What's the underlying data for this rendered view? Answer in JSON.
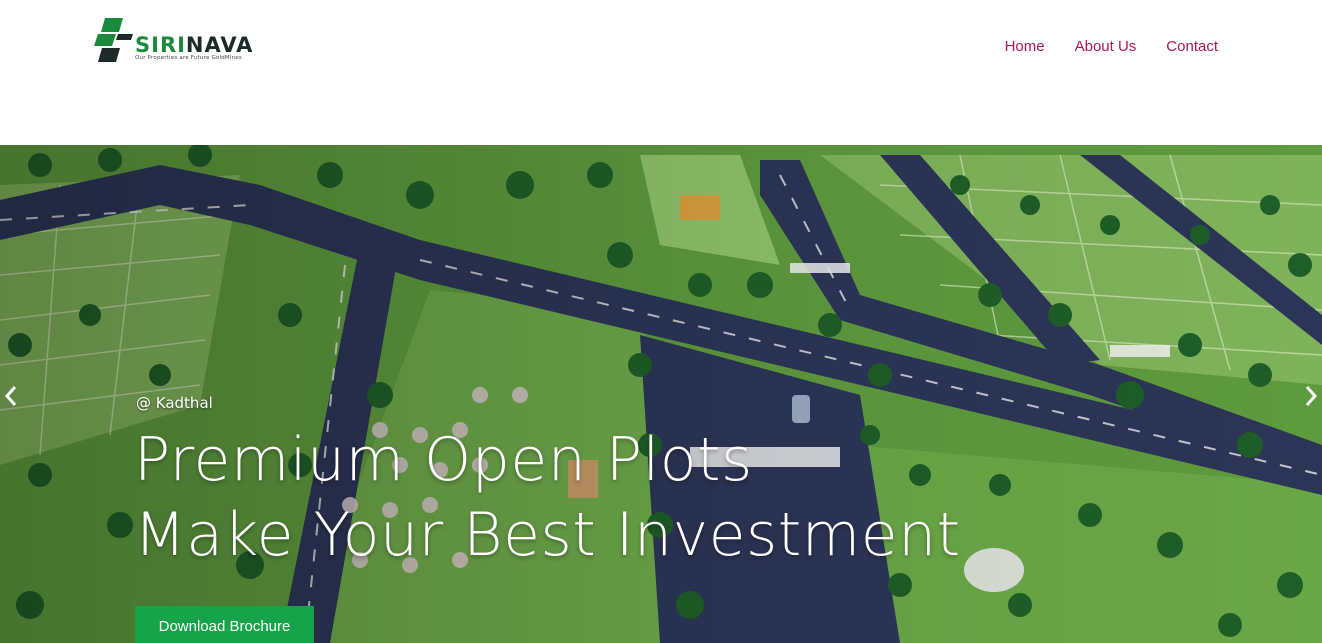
{
  "brand": {
    "name_part1": "SIRI",
    "name_part2": "NAVA",
    "tagline": "Our Properties are Future GoldMines",
    "primary_color": "#1b8a3c",
    "dark_color": "#1c2a2a"
  },
  "nav": {
    "items": [
      {
        "label": "Home"
      },
      {
        "label": "About Us"
      },
      {
        "label": "Contact"
      }
    ],
    "link_color": "#a3195b"
  },
  "hero": {
    "location": "@ Kadthal",
    "headline_line1": "Premium Open Plots",
    "headline_line2": "Make Your Best Investment",
    "cta_label": "Download Brochure",
    "cta_color": "#17a34a",
    "prev_icon": "chevron-left-icon",
    "next_icon": "chevron-right-icon"
  }
}
